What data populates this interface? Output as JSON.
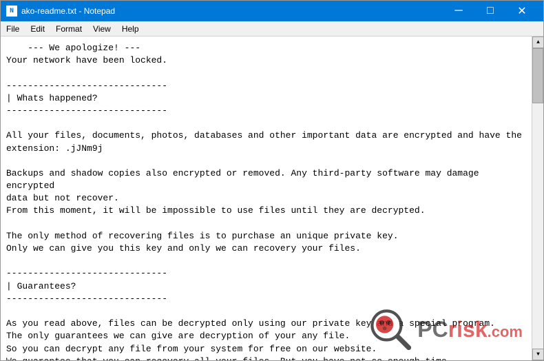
{
  "window": {
    "title": "ako-readme.txt - Notepad",
    "icon_label": "N"
  },
  "menu": {
    "items": [
      "File",
      "Edit",
      "Format",
      "View",
      "Help"
    ]
  },
  "content": {
    "text": "    --- We apologize! ---\nYour network have been locked.\n\n------------------------------\n| Whats happened?\n------------------------------\n\nAll your files, documents, photos, databases and other important data are encrypted and have the\nextension: .jJNm9j\n\nBackups and shadow copies also encrypted or removed. Any third-party software may damage encrypted\ndata but not recover.\nFrom this moment, it will be impossible to use files until they are decrypted.\n\nThe only method of recovering files is to purchase an unique private key.\nOnly we can give you this key and only we can recovery your files.\n\n------------------------------\n| Guarantees?\n------------------------------\n\nAs you read above, files can be decrypted only using our private key and a special program.\nThe only guarantees we can give are decryption of your any file.\nSo you can decrypt any file from your system for free on our website.\nWe guarantee that you can recovery all your files. But you have not so enough time.\n\n------------------------------\n| How to recovery my files?\n------------------------------"
  },
  "controls": {
    "minimize": "─",
    "maximize": "□",
    "close": "✕"
  }
}
